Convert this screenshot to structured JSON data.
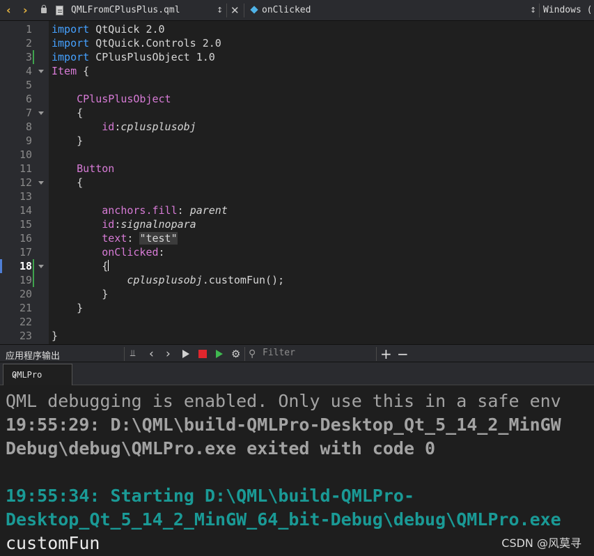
{
  "editor_toolbar": {
    "file_name": "QMLFromCPlusPlus.qml",
    "symbol": "onClicked",
    "line_ending": "Windows (",
    "back_icon": "chevron-left-icon",
    "forward_icon": "chevron-right-icon"
  },
  "code": {
    "line_numbers": [
      "1",
      "2",
      "3",
      "4",
      "5",
      "6",
      "7",
      "8",
      "9",
      "10",
      "11",
      "12",
      "13",
      "14",
      "15",
      "16",
      "17",
      "18",
      "19",
      "20",
      "21",
      "22",
      "23"
    ],
    "current_line": "18",
    "lines": [
      "import QtQuick 2.0",
      "import QtQuick.Controls 2.0",
      "import CPlusPlusObject 1.0",
      "Item {",
      "",
      "    CPlusPlusObject",
      "    {",
      "        id:cplusplusobj",
      "    }",
      "",
      "    Button",
      "    {",
      "",
      "        anchors.fill: parent",
      "        id:signalnopara",
      "        text: \"test\"",
      "        onClicked:",
      "        {",
      "            cplusplusobj.customFun();",
      "        }",
      "    }",
      "",
      "}"
    ]
  },
  "output_pane": {
    "title": "应用程序输出",
    "filter_placeholder": "Filter",
    "add_label": "+",
    "remove_label": "−",
    "tab_label": "QMLPro",
    "lines": [
      "QML debugging is enabled. Only use this in a safe env",
      "19:55:29: D:\\QML\\build-QMLPro-Desktop_Qt_5_14_2_MinGW",
      "Debug\\debug\\QMLPro.exe exited with code 0",
      "",
      "19:55:34: Starting D:\\QML\\build-QMLPro-",
      "Desktop_Qt_5_14_2_MinGW_64_bit-Debug\\debug\\QMLPro.exe",
      "customFun"
    ]
  },
  "watermark": "CSDN @风莫寻",
  "colors": {
    "keyword": "#45a1ff",
    "type": "#d77bd6",
    "stop_button": "#e0262d",
    "status_teal": "#1a9a96"
  }
}
